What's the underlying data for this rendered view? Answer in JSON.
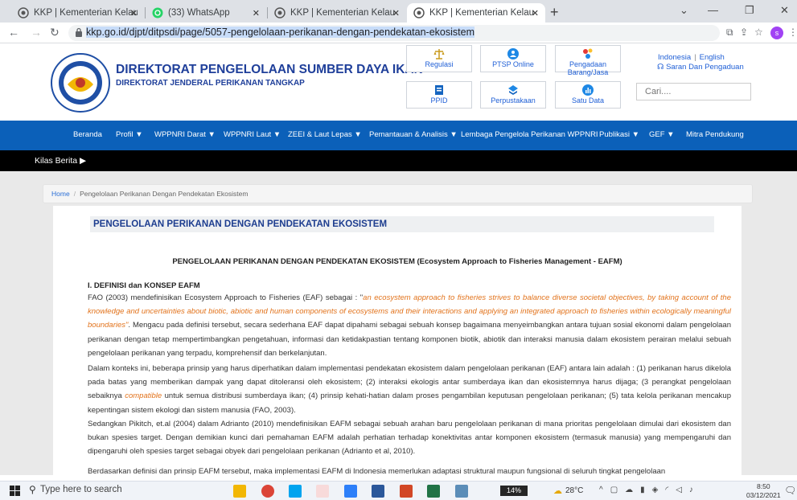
{
  "browser": {
    "tabs": [
      {
        "title": "KKP | Kementerian Kelautan dan",
        "active": false
      },
      {
        "title": "(33) WhatsApp",
        "active": false
      },
      {
        "title": "KKP | Kementerian Kelautan dan",
        "active": false
      },
      {
        "title": "KKP | Kementerian Kelautan dan",
        "active": true
      }
    ],
    "new_tab": "+",
    "url": "kkp.go.id/djpt/ditpsdi/page/5057-pengelolaan-perikanan-dengan-pendekatan-ekosistem",
    "profile_initial": "s"
  },
  "site": {
    "title": "DIREKTORAT PENGELOLAAN SUMBER DAYA IKAN",
    "subtitle": "DIREKTORAT JENDERAL PERIKANAN TANGKAP",
    "quicklinks": [
      {
        "label": "Regulasi",
        "icon": "scale-icon",
        "color": "#c99a1c"
      },
      {
        "label": "PTSP Online",
        "icon": "people-icon",
        "color": "#1e88e5"
      },
      {
        "label": "Pengadaan Barang/Jasa",
        "icon": "dots-icon",
        "color": "#e53935"
      },
      {
        "label": "PPID",
        "icon": "ppid-icon",
        "color": "#1565c0"
      },
      {
        "label": "Perpustakaan",
        "icon": "book-icon",
        "color": "#1e88e5"
      },
      {
        "label": "Satu Data",
        "icon": "chart-icon",
        "color": "#1e88e5"
      }
    ],
    "lang_id": "Indonesia",
    "lang_en": "English",
    "lang_sep": "|",
    "saran": "Saran Dan Pengaduan",
    "search_placeholder": "Cari....",
    "nav": [
      "Beranda",
      "Profil ▼",
      "WPPNRI Darat ▼",
      "WPPNRI Laut ▼",
      "ZEEI & Laut Lepas ▼",
      "Pemantauan & Analisis ▼",
      "Lembaga Pengelola Perikanan WPPNRI",
      "Publikasi ▼",
      "GEF ▼",
      "Mitra Pendukung"
    ],
    "kilas": "Kilas Berita ▶",
    "breadcrumb_home": "Home",
    "breadcrumb_current": "Pengelolaan Perikanan Dengan Pendekatan Ekosistem",
    "breadcrumb_sep": "/"
  },
  "article": {
    "page_title": "PENGELOLAAN PERIKANAN DENGAN PENDEKATAN EKOSISTEM",
    "heading": "PENGELOLAAN PERIKANAN DENGAN PENDEKATAN EKOSISTEM  (Ecosystem Approach to Fisheries Management - EAFM)",
    "section": "I. DEFINISI dan KONSEP EAFM",
    "p1_a": "FAO (2003) mendefinisikan Ecosystem Approach to Fisheries (EAF) sebagai : \"",
    "p1_quote": "an ecosystem approach to fisheries strives to balance diverse societal objectives, by taking account of the knowledge and uncertainties about biotic, abiotic and human components of ecosystems and their interactions and applying an integrated approach to fisheries within ecologically meaningful boundaries\"",
    "p1_b": ". Mengacu pada definisi tersebut, secara sederhana EAF dapat dipahami sebagai sebuah konsep bagaimana menyeimbangkan antara tujuan sosial ekonomi dalam pengelolaan perikanan dengan tetap mempertimbangkan pengetahuan, informasi dan ketidakpastian tentang komponen biotik, abiotik dan interaksi manusia dalam ekosistem perairan melalui sebuah pengelolaan perikanan yang terpadu, komprehensif dan berkelanjutan.",
    "p2_a": "Dalam konteks ini, beberapa prinsip yang harus diperhatikan dalam implementasi pendekatan ekosistem dalam pengelolaan perikanan (EAF) antara lain adalah : (1) perikanan harus dikelola pada batas yang memberikan dampak yang dapat ditoleransi oleh ekosistem; (2) interaksi ekologis antar sumberdaya ikan dan ekosistemnya harus dijaga; (3 perangkat pengelolaan sebaiknya ",
    "p2_it": "compatible",
    "p2_b": " untuk semua distribusi sumberdaya ikan; (4) prinsip kehati-hatian dalam proses pengambilan keputusan pengelolaan perikanan; (5) tata kelola perikanan mencakup kepentingan sistem ekologi dan sistem manusia (FAO, 2003).",
    "p3": "Sedangkan Pikitch, et.al (2004) dalam Adrianto (2010) mendefinisikan EAFM sebagai sebuah arahan baru pengelolaan perikanan di mana prioritas pengelolaan dimulai dari ekosistem dan bukan spesies target. Dengan demikian kunci dari pemahaman EAFM adalah perhatian terhadap konektivitas antar komponen ekosistem (termasuk manusia) yang mempengaruhi dan dipengaruhi oleh spesies target sebagai obyek dari pengelolaan perikanan (Adrianto et al, 2010).",
    "p4": "Berdasarkan definisi dan prinsip EAFM tersebut, maka implementasi EAFM di Indonesia memerlukan adaptasi struktural maupun fungsional di seluruh tingkat pengelolaan"
  },
  "taskbar": {
    "search": "Type here to search",
    "battery": "14%",
    "weather": "28°C",
    "time": "8:50",
    "date": "03/12/2021"
  }
}
